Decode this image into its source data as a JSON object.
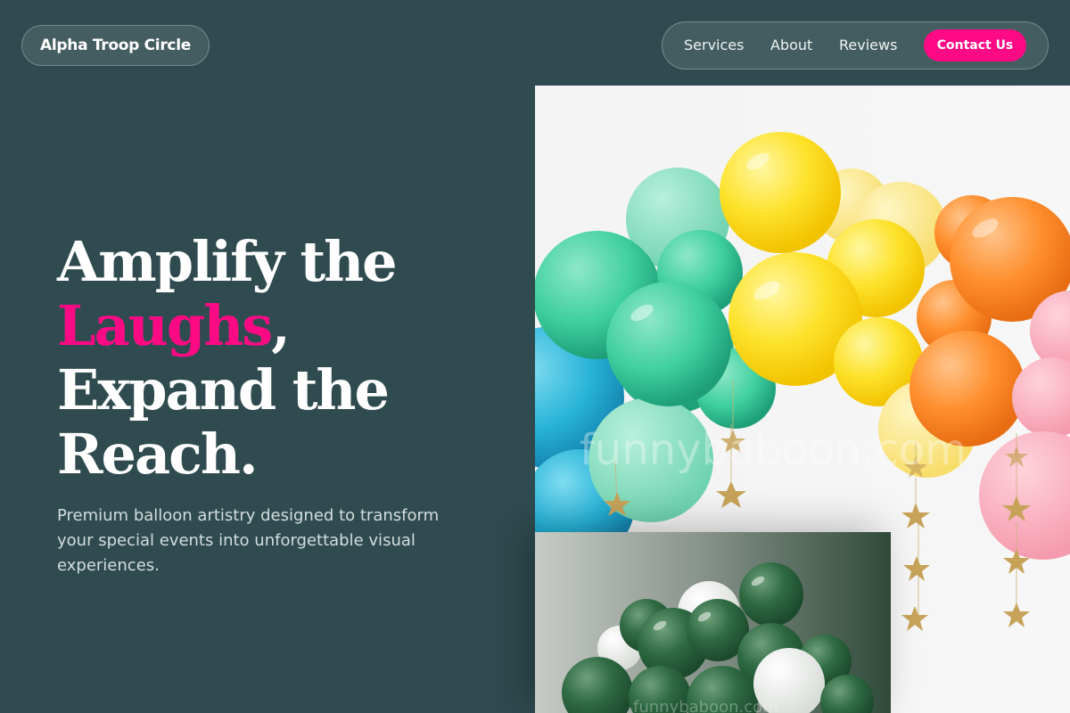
{
  "header": {
    "brand": "Alpha Troop Circle",
    "nav": {
      "services": "Services",
      "about": "About",
      "reviews": "Reviews",
      "contact": "Contact Us"
    }
  },
  "hero": {
    "headline_line1": "Amplify the",
    "headline_accent": "Laughs",
    "headline_comma": ",",
    "headline_line3": "Expand the",
    "headline_line4": "Reach.",
    "subtitle": "Premium balloon artistry designed to transform your special events into unforgettable visual experiences."
  },
  "images": {
    "main_watermark": "funnybaboon.com",
    "secondary_watermark": "funnybaboon.com"
  },
  "colors": {
    "background": "#2f4b4f",
    "accent": "#ff0a85",
    "text": "#ffffff"
  }
}
